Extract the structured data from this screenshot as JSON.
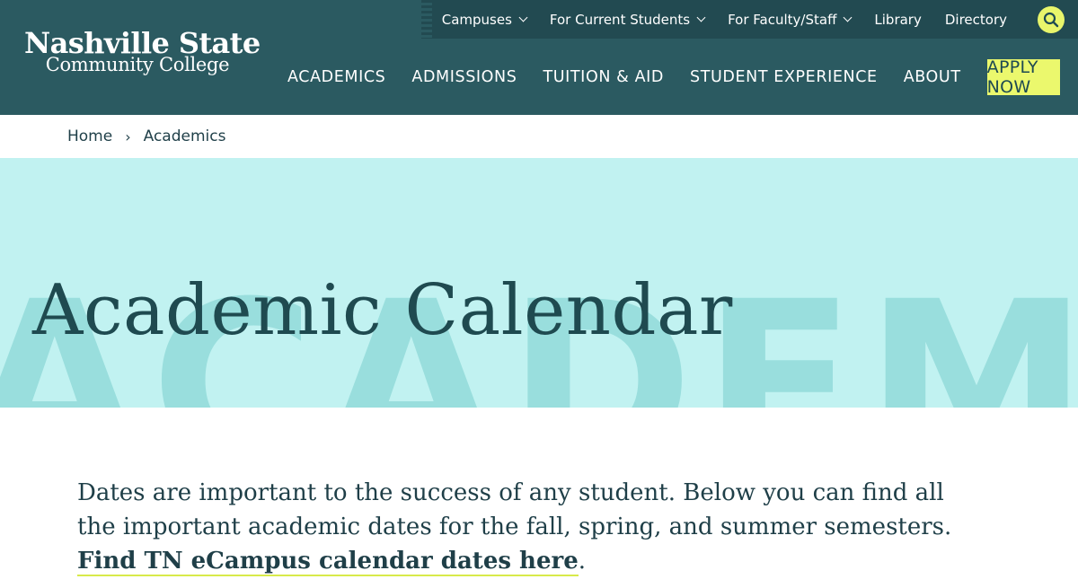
{
  "header": {
    "logo": {
      "line1": "Nashville State",
      "line2": "Community College"
    },
    "utility_nav": [
      {
        "label": "Campuses",
        "dropdown": true
      },
      {
        "label": "For Current Students",
        "dropdown": true
      },
      {
        "label": "For Faculty/Staff",
        "dropdown": true
      },
      {
        "label": "Library",
        "dropdown": false
      },
      {
        "label": "Directory",
        "dropdown": false
      }
    ],
    "search_icon": "search-icon",
    "main_nav": [
      "ACADEMICS",
      "ADMISSIONS",
      "TUITION & AID",
      "STUDENT EXPERIENCE",
      "ABOUT"
    ],
    "apply_label": "APPLY NOW"
  },
  "breadcrumb": {
    "home": "Home",
    "separator": "›",
    "current": "Academics"
  },
  "hero": {
    "watermark": "ACADEMIC CA",
    "title": "Academic Calendar"
  },
  "intro": {
    "text": "Dates are important to the success of any student. Below you can find all the important academic dates for the fall, spring, and summer semesters. ",
    "link_text": "Find TN eCampus calendar dates here",
    "suffix": "."
  },
  "colors": {
    "header_bg": "#2b5a61",
    "utility_bg": "#224a51",
    "accent": "#ebf86d",
    "hero_bg": "#c1f2f1",
    "watermark": "#99dedd",
    "text_dark": "#1f3f48"
  }
}
